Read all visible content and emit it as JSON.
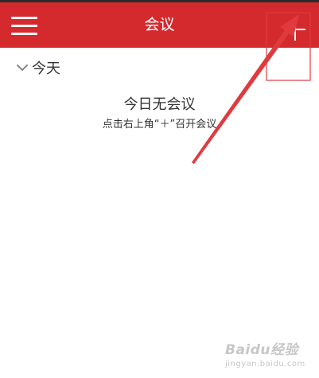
{
  "header": {
    "title": "会议",
    "menu_icon": "menu-icon",
    "add_icon": "plus-icon",
    "color": "#d42a2e"
  },
  "section": {
    "day_label": "今天",
    "collapse_icon": "chevron-down-icon"
  },
  "empty_state": {
    "title": "今日无会议",
    "hint": "点击右上角“＋”召开会议"
  },
  "annotation": {
    "color": "#e03a3e"
  },
  "watermark": {
    "logo": "Baidu经验",
    "url": "jingyan.baidu.com"
  }
}
